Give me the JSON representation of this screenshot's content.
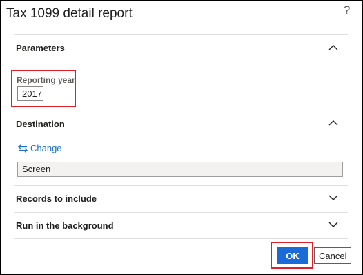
{
  "dialog": {
    "title": "Tax 1099 detail report",
    "help_glyph": "?"
  },
  "parameters": {
    "header": "Parameters",
    "expanded": true,
    "reporting_year_label": "Reporting year",
    "reporting_year_value": "2017"
  },
  "destination": {
    "header": "Destination",
    "expanded": true,
    "change_label": "Change",
    "value": "Screen"
  },
  "records": {
    "header": "Records to include",
    "expanded": false
  },
  "background": {
    "header": "Run in the background",
    "expanded": false
  },
  "footer": {
    "ok_label": "OK",
    "cancel_label": "Cancel"
  },
  "colors": {
    "accent": "#1a6bd8",
    "link": "#1a73c8",
    "highlight": "#e3202a"
  }
}
